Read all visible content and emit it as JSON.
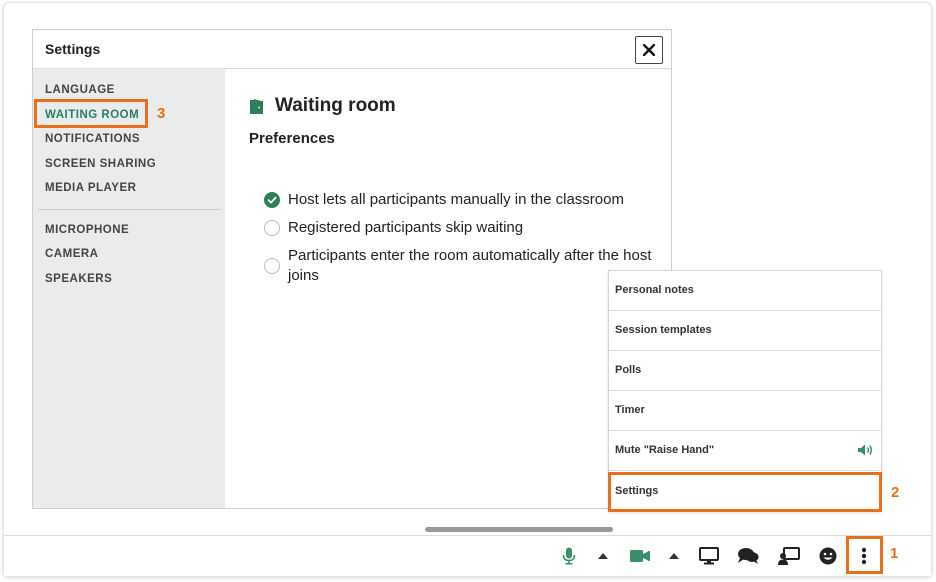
{
  "dialog": {
    "title": "Settings",
    "close_icon": "close-icon"
  },
  "sidebar": {
    "items": [
      {
        "label": "LANGUAGE"
      },
      {
        "label": "WAITING ROOM",
        "active": true
      },
      {
        "label": "NOTIFICATIONS"
      },
      {
        "label": "SCREEN SHARING"
      },
      {
        "label": "MEDIA PLAYER"
      },
      {
        "label": "MICROPHONE"
      },
      {
        "label": "CAMERA"
      },
      {
        "label": "SPEAKERS"
      }
    ]
  },
  "content": {
    "title": "Waiting room",
    "title_icon": "door-icon",
    "preferences_heading": "Preferences",
    "options": [
      {
        "label": "Host lets all participants manually in the classroom",
        "checked": true
      },
      {
        "label": "Registered participants skip waiting",
        "checked": false
      },
      {
        "label": "Participants enter the room automatically after the host joins",
        "checked": false
      }
    ]
  },
  "menu": {
    "items": [
      {
        "label": "Personal notes"
      },
      {
        "label": "Session templates"
      },
      {
        "label": "Polls"
      },
      {
        "label": "Timer"
      },
      {
        "label": "Mute \"Raise Hand\"",
        "icon": "speaker-icon"
      },
      {
        "label": "Settings"
      }
    ]
  },
  "annotations": {
    "step1": "1",
    "step2": "2",
    "step3": "3"
  },
  "toolbar": {
    "icons": [
      "microphone-icon",
      "caret-up-icon",
      "camera-icon",
      "caret-up-icon",
      "screen-share-icon",
      "chat-icon",
      "presenter-icon",
      "emoji-icon",
      "more-vertical-icon"
    ]
  },
  "colors": {
    "accent": "#2e7d5b",
    "highlight": "#e8701a"
  }
}
